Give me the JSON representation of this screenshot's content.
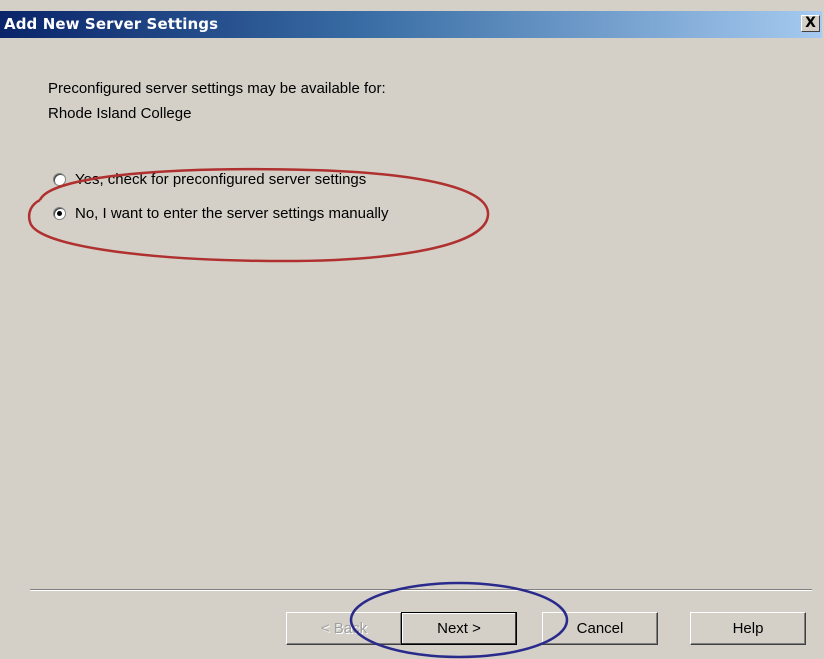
{
  "dialog": {
    "title": "Add New Server Settings",
    "close_label": "X"
  },
  "intro": {
    "line1": "Preconfigured server settings may be available for:",
    "line2": "Rhode Island College"
  },
  "options": [
    {
      "label": "Yes, check for preconfigured server settings",
      "selected": false
    },
    {
      "label": "No, I want to enter the server settings manually",
      "selected": true
    }
  ],
  "buttons": {
    "back": "< Back",
    "next": "Next >",
    "cancel": "Cancel",
    "help": "Help"
  },
  "annotations": {
    "option_circle_color": "#b03030",
    "next_circle_color": "#2a2a8c"
  }
}
